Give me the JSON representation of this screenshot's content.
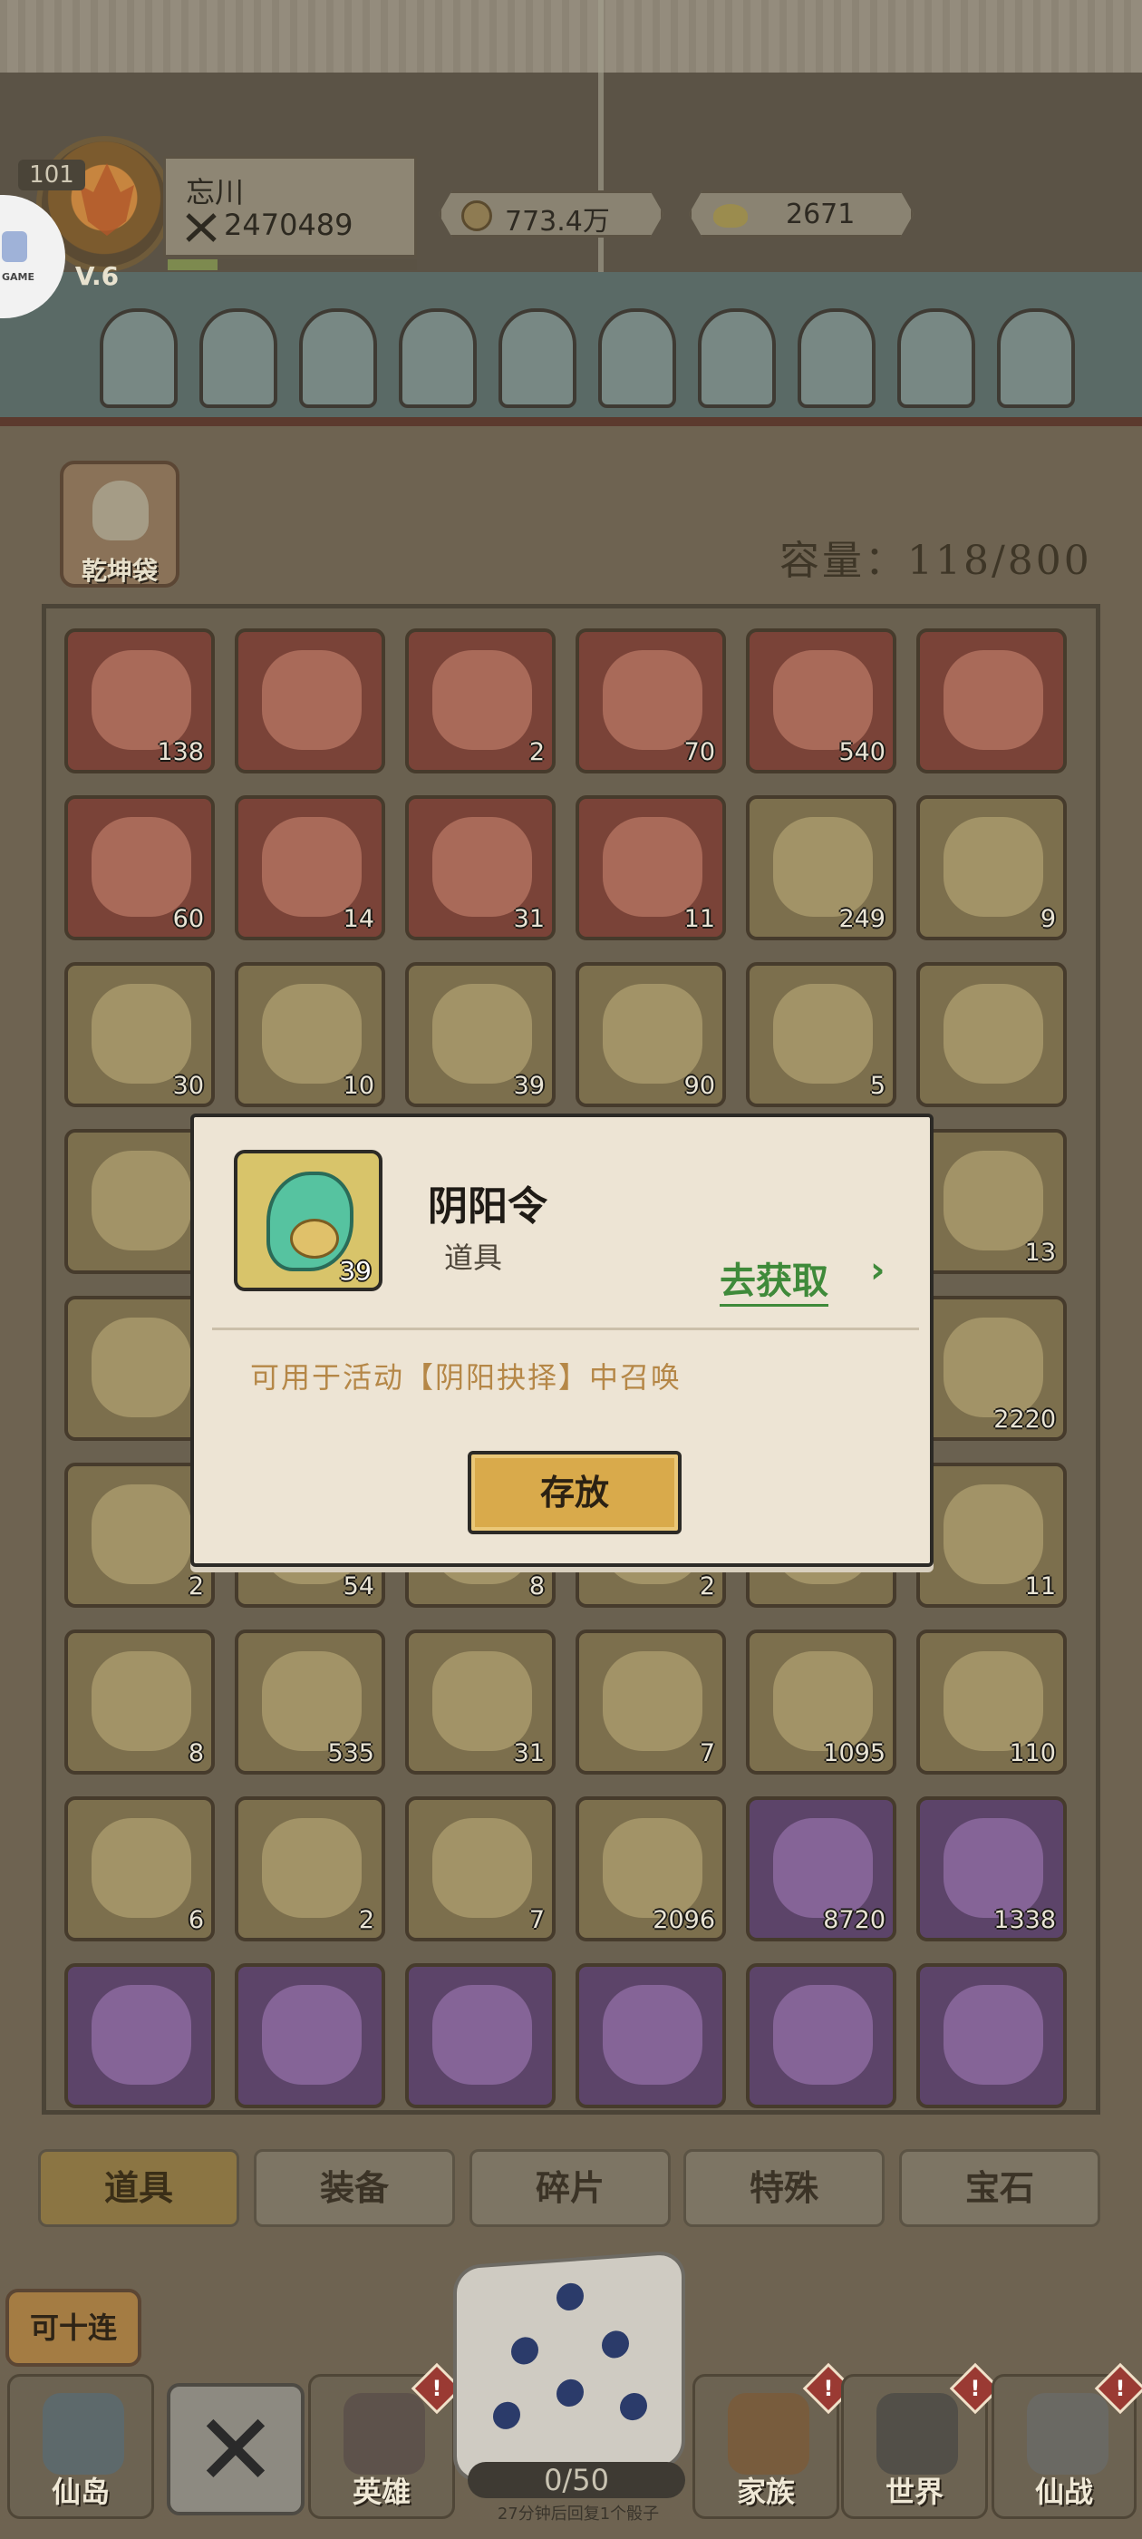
{
  "player": {
    "level": "101",
    "vip": "V.6",
    "name": "忘川",
    "power": "2470489"
  },
  "resources": {
    "coins": "773.4万",
    "ingots": "2671"
  },
  "side_button": {
    "label": "GAME"
  },
  "bag": {
    "title": "乾坤袋",
    "capacity": "容量：118/800"
  },
  "items": [
    {
      "count": "138",
      "rarity": "red",
      "icon": "herb-icon"
    },
    {
      "count": "",
      "rarity": "red",
      "icon": "blocks-icon"
    },
    {
      "count": "2",
      "rarity": "red",
      "icon": "hairpin-icon"
    },
    {
      "count": "70",
      "rarity": "red",
      "icon": "chest-icon"
    },
    {
      "count": "540",
      "rarity": "red",
      "icon": "crystal-icon"
    },
    {
      "count": "",
      "rarity": "red",
      "icon": "gem-icon"
    },
    {
      "count": "60",
      "rarity": "red",
      "icon": "peach-icon"
    },
    {
      "count": "14",
      "rarity": "red",
      "icon": "key-icon"
    },
    {
      "count": "31",
      "rarity": "red",
      "icon": "treasure-chest-icon"
    },
    {
      "count": "11",
      "rarity": "red",
      "icon": "gold-chest-icon"
    },
    {
      "count": "249",
      "rarity": "yellow",
      "icon": "ore-icon"
    },
    {
      "count": "9",
      "rarity": "yellow",
      "icon": "fragment-icon"
    },
    {
      "count": "30",
      "rarity": "yellow",
      "icon": "scroll-icon"
    },
    {
      "count": "10",
      "rarity": "yellow",
      "icon": "bell-icon"
    },
    {
      "count": "39",
      "rarity": "yellow",
      "icon": "jade-token-icon"
    },
    {
      "count": "90",
      "rarity": "yellow",
      "icon": "pink-ore-icon"
    },
    {
      "count": "5",
      "rarity": "yellow",
      "icon": "rolled-scroll-icon"
    },
    {
      "count": "",
      "rarity": "yellow",
      "icon": "blue-book-icon"
    },
    {
      "count": "",
      "rarity": "yellow",
      "icon": "blue-book-icon"
    },
    {
      "count": "",
      "rarity": "yellow",
      "icon": "hidden-icon"
    },
    {
      "count": "",
      "rarity": "yellow",
      "icon": "hidden-icon"
    },
    {
      "count": "",
      "rarity": "yellow",
      "icon": "hidden-icon"
    },
    {
      "count": "",
      "rarity": "yellow",
      "icon": "hidden-icon"
    },
    {
      "count": "13",
      "rarity": "yellow",
      "icon": "fortune-card-icon"
    },
    {
      "count": "",
      "rarity": "yellow",
      "icon": "telescope-icon"
    },
    {
      "count": "",
      "rarity": "yellow",
      "icon": "hidden-icon"
    },
    {
      "count": "",
      "rarity": "yellow",
      "icon": "hidden-icon"
    },
    {
      "count": "",
      "rarity": "yellow",
      "icon": "hidden-icon"
    },
    {
      "count": "",
      "rarity": "yellow",
      "icon": "hidden-icon"
    },
    {
      "count": "2220",
      "rarity": "yellow",
      "icon": "amber-gem-icon"
    },
    {
      "count": "2",
      "rarity": "yellow",
      "icon": "seal-icon"
    },
    {
      "count": "54",
      "rarity": "yellow",
      "icon": "hidden-icon"
    },
    {
      "count": "8",
      "rarity": "yellow",
      "icon": "hidden-icon"
    },
    {
      "count": "2",
      "rarity": "yellow",
      "icon": "hidden-icon"
    },
    {
      "count": "",
      "rarity": "yellow",
      "icon": "hidden-icon"
    },
    {
      "count": "11",
      "rarity": "yellow",
      "icon": "potion-icon"
    },
    {
      "count": "8",
      "rarity": "yellow",
      "icon": "bowl-icon"
    },
    {
      "count": "535",
      "rarity": "yellow",
      "icon": "envelope-icon"
    },
    {
      "count": "31",
      "rarity": "yellow",
      "icon": "flask-icon"
    },
    {
      "count": "7",
      "rarity": "yellow",
      "icon": "red-scroll-icon"
    },
    {
      "count": "1095",
      "rarity": "yellow",
      "icon": "gold-crystal-icon"
    },
    {
      "count": "110",
      "rarity": "yellow",
      "icon": "ring-icon"
    },
    {
      "count": "6",
      "rarity": "yellow",
      "icon": "shield-icon"
    },
    {
      "count": "2",
      "rarity": "yellow",
      "icon": "paper-icon"
    },
    {
      "count": "7",
      "rarity": "yellow",
      "icon": "talisman-icon"
    },
    {
      "count": "2096",
      "rarity": "yellow",
      "icon": "copper-crystal-icon"
    },
    {
      "count": "8720",
      "rarity": "purple",
      "icon": "emerald-icon"
    },
    {
      "count": "1338",
      "rarity": "purple",
      "icon": "amethyst-icon"
    },
    {
      "count": "",
      "rarity": "purple",
      "icon": "purple-mound-icon"
    },
    {
      "count": "",
      "rarity": "purple",
      "icon": "coins-icon"
    },
    {
      "count": "",
      "rarity": "purple",
      "icon": "cart-icon"
    },
    {
      "count": "",
      "rarity": "purple",
      "icon": "plum-icon"
    },
    {
      "count": "",
      "rarity": "purple",
      "icon": "yellow-crystal-icon"
    },
    {
      "count": "",
      "rarity": "purple",
      "icon": "rune-stone-icon"
    }
  ],
  "tabs": [
    {
      "label": "道具",
      "active": true
    },
    {
      "label": "装备",
      "active": false
    },
    {
      "label": "碎片",
      "active": false
    },
    {
      "label": "特殊",
      "active": false
    },
    {
      "label": "宝石",
      "active": false
    }
  ],
  "bottom_nav": [
    {
      "label": "仙岛",
      "icon": "palace-icon",
      "alert": false
    },
    {
      "label": "英雄",
      "icon": "hero-icon",
      "alert": true
    },
    {
      "label": "家族",
      "icon": "banner-icon",
      "alert": true
    },
    {
      "label": "世界",
      "icon": "horse-icon",
      "alert": true
    },
    {
      "label": "仙战",
      "icon": "axe-icon",
      "alert": true
    }
  ],
  "ten_roll_button": "可十连",
  "dice": {
    "counter": "0/50",
    "hint": "27分钟后回复1个骰子"
  },
  "modal": {
    "item_name": "阴阳令",
    "item_type": "道具",
    "item_count": "39",
    "get_link": "去获取",
    "description": "可用于活动【阴阳抉择】中召唤",
    "store_button": "存放"
  },
  "colors": {
    "red_cell": "#7a4338",
    "yellow_cell": "#7c6f4d",
    "purple_cell": "#5c4469",
    "link_green": "#3f8a3a",
    "desc_gold": "#b58747"
  }
}
